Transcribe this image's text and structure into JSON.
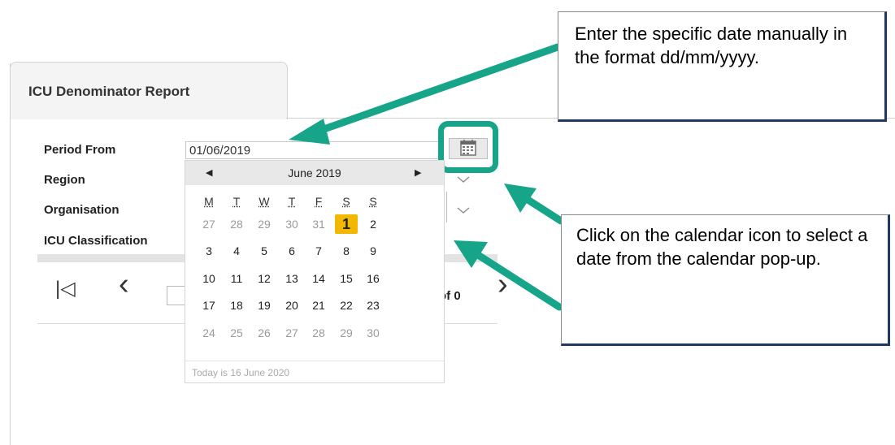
{
  "tab": {
    "title": "ICU Denominator Report"
  },
  "form": {
    "labels": {
      "period_from": "Period From",
      "region": "Region",
      "organisation": "Organisation",
      "icu_classification": "ICU Classification"
    },
    "period_from_value": "01/06/2019"
  },
  "pager": {
    "first_glyph": "|◁",
    "prev_glyph": "‹",
    "next_glyph": "›",
    "of_text": "of 0"
  },
  "calendar": {
    "month_title": "June 2019",
    "prev_glyph": "◀",
    "next_glyph": "▶",
    "weekdays": [
      "M",
      "T",
      "W",
      "T",
      "F",
      "S",
      "S"
    ],
    "weeks": [
      [
        {
          "d": "27",
          "m": true
        },
        {
          "d": "28",
          "m": true
        },
        {
          "d": "29",
          "m": true
        },
        {
          "d": "30",
          "m": true
        },
        {
          "d": "31",
          "m": true
        },
        {
          "d": "1",
          "sel": true
        },
        {
          "d": "2"
        }
      ],
      [
        {
          "d": "3"
        },
        {
          "d": "4"
        },
        {
          "d": "5"
        },
        {
          "d": "6"
        },
        {
          "d": "7"
        },
        {
          "d": "8"
        },
        {
          "d": "9"
        }
      ],
      [
        {
          "d": "10"
        },
        {
          "d": "11"
        },
        {
          "d": "12"
        },
        {
          "d": "13"
        },
        {
          "d": "14"
        },
        {
          "d": "15"
        },
        {
          "d": "16"
        }
      ],
      [
        {
          "d": "17"
        },
        {
          "d": "18"
        },
        {
          "d": "19"
        },
        {
          "d": "20"
        },
        {
          "d": "21"
        },
        {
          "d": "22"
        },
        {
          "d": "23"
        }
      ],
      [
        {
          "d": "24",
          "m": true
        },
        {
          "d": "25",
          "m": true
        },
        {
          "d": "26",
          "m": true
        },
        {
          "d": "27",
          "m": true
        },
        {
          "d": "28",
          "m": true
        },
        {
          "d": "29",
          "m": true
        },
        {
          "d": "30",
          "m": true
        }
      ]
    ],
    "today_text": "Today is 16 June 2020"
  },
  "callouts": {
    "manual_entry": "Enter the specific date manually in the format dd/mm/yyyy.",
    "calendar_icon": "Click on the calendar icon to select a date from the calendar pop-up."
  },
  "colors": {
    "accent": "#17a589",
    "selected_day": "#f2b800",
    "callout_border": "#1f3864"
  }
}
